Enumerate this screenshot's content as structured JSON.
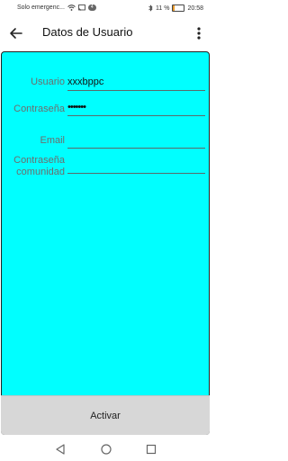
{
  "status_bar": {
    "carrier": "Solo emergenc...",
    "sim_badge": "4",
    "battery_percent": "11 %",
    "time": "20:58",
    "battery_level": 0.11,
    "icons": [
      "wifi-icon",
      "cast-icon",
      "bluetooth-icon",
      "battery-icon"
    ]
  },
  "app_bar": {
    "title": "Datos de Usuario",
    "icons": [
      "back-arrow-icon",
      "more-vert-icon"
    ]
  },
  "form": {
    "usuario": {
      "label": "Usuario",
      "value": "xxxbppc"
    },
    "contrasena": {
      "label": "Contraseña",
      "value": "•••••••"
    },
    "email": {
      "label": "Email",
      "value": ""
    },
    "contrasena_comunidad": {
      "label_line1": "Contraseña",
      "label_line2": "comunidad",
      "value": ""
    },
    "background_color": "#00ffff"
  },
  "activar_button": {
    "label": "Activar"
  },
  "nav_bar": {
    "icons": [
      "back-triangle-icon",
      "home-circle-icon",
      "recents-square-icon"
    ]
  }
}
